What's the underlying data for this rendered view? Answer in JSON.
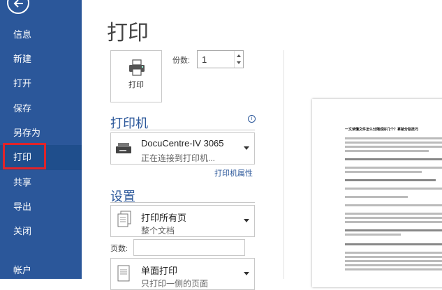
{
  "sidebar": {
    "items": [
      {
        "label": "信息"
      },
      {
        "label": "新建"
      },
      {
        "label": "打开"
      },
      {
        "label": "保存"
      },
      {
        "label": "另存为"
      },
      {
        "label": "打印"
      },
      {
        "label": "共享"
      },
      {
        "label": "导出"
      },
      {
        "label": "关闭"
      },
      {
        "label": "帐户"
      }
    ],
    "active": "打印"
  },
  "main": {
    "title": "打印",
    "print_button": {
      "label": "打印"
    },
    "copies": {
      "label": "份数:",
      "value": "1"
    },
    "printer": {
      "section_title": "打印机",
      "name": "DocuCentre-IV 3065",
      "status": "正在连接到打印机...",
      "properties_link": "打印机属性"
    },
    "settings": {
      "section_title": "设置",
      "range": {
        "main": "打印所有页",
        "sub": "整个文档"
      },
      "pages_label": "页数:",
      "pages_value": "",
      "sides": {
        "main": "单面打印",
        "sub": "只打印一侧的页面"
      }
    }
  },
  "preview": {
    "doc_title": "一文读懂文件怎么分隔成好几个？拿破分割技巧",
    "paragraph_labels": [
      "第一步，打开我们需要分割的文档",
      "第二步，点击上方的【跳转文件】按钮",
      "第三步，在弹出窗口中选择【分割模式】",
      "第四步，确认无误后点击开始分割"
    ]
  },
  "colors": {
    "sidebar_bg": "#2b579a",
    "active_item_bg": "#1f4e8c",
    "highlight_box": "#e0242a",
    "accent_text": "#2b579a"
  },
  "icons": [
    "back-arrow-icon",
    "printer-icon",
    "printer-device-icon",
    "pages-icon",
    "single-side-icon",
    "info-icon"
  ]
}
